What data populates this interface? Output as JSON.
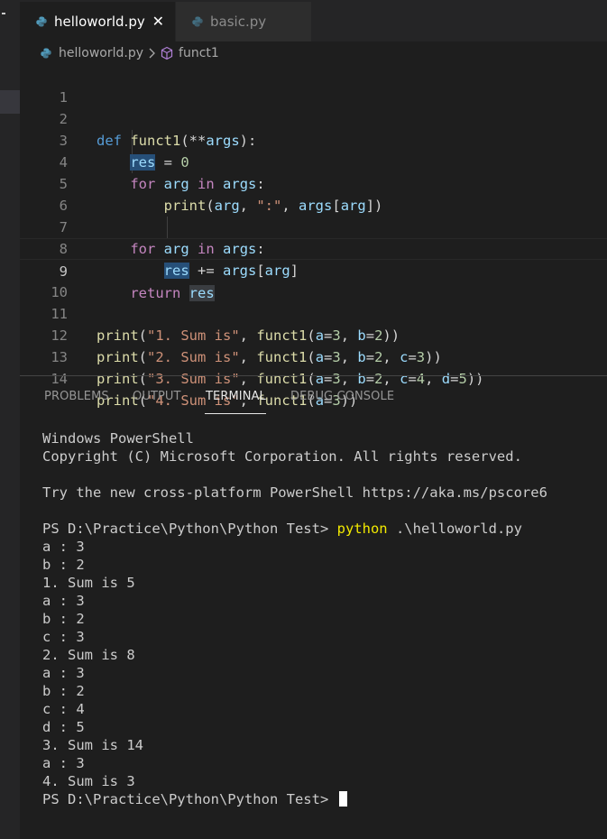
{
  "editor": {
    "tabs": [
      {
        "label": "helloworld.py",
        "close": "✕",
        "active": true
      },
      {
        "label": "basic.py",
        "active": false
      }
    ],
    "breadcrumb": {
      "file": "helloworld.py",
      "symbol": "funct1"
    }
  },
  "code": {
    "lines": [
      {
        "n": "1"
      },
      {
        "n": "2"
      },
      {
        "n": "3"
      },
      {
        "n": "4"
      },
      {
        "n": "5"
      },
      {
        "n": "6"
      },
      {
        "n": "7"
      },
      {
        "n": "8"
      },
      {
        "n": "9"
      },
      {
        "n": "10"
      },
      {
        "n": "11"
      },
      {
        "n": "12"
      },
      {
        "n": "13"
      },
      {
        "n": "14"
      }
    ],
    "t": {
      "def": "def",
      "funct1": "funct1",
      "args_kw": "args",
      "res": "res",
      "eq": " = ",
      "zero": "0",
      "for": "for",
      "arg": "arg",
      "in": "in",
      "args": "args",
      "print": "print",
      "colon_str": "\":\"",
      "pluseq": " += ",
      "return": "return",
      "s1": "\"1. Sum is\"",
      "s2": "\"2. Sum is\"",
      "s3": "\"3. Sum is\"",
      "s4": "\"4. Sum is\"",
      "a": "a",
      "b": "b",
      "c": "c",
      "d": "d",
      "n2": "2",
      "n3": "3",
      "n4": "4",
      "n5": "5"
    }
  },
  "panel": {
    "tabs": [
      "PROBLEMS",
      "OUTPUT",
      "TERMINAL",
      "DEBUG CONSOLE"
    ],
    "active_tab": "TERMINAL"
  },
  "terminal": {
    "header1": "Windows PowerShell",
    "header2": "Copyright (C) Microsoft Corporation. All rights reserved.",
    "header3": "Try the new cross-platform PowerShell https://aka.ms/pscore6",
    "prompt": "PS D:\\Practice\\Python\\Python Test> ",
    "command": "python",
    "command_arg": " .\\helloworld.py",
    "output": [
      "a : 3",
      "b : 2",
      "1. Sum is 5",
      "a : 3",
      "b : 2",
      "c : 3",
      "2. Sum is 8",
      "a : 3",
      "b : 2",
      "c : 4",
      "d : 5",
      "3. Sum is 14",
      "a : 3",
      "4. Sum is 3"
    ],
    "final_prompt": "PS D:\\Practice\\Python\\Python Test> "
  },
  "colors": {
    "keyword": "#569cd6",
    "control": "#c586c0",
    "function": "#dcdcaa",
    "variable": "#9cdcfe",
    "string": "#ce9178",
    "number": "#b5cea8",
    "command": "#f2e900"
  }
}
